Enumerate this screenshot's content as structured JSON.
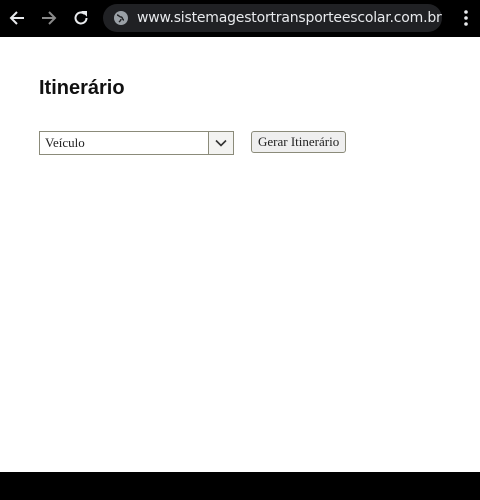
{
  "browser": {
    "url": "www.sistemagestortransporteescolar.com.br",
    "icons": {
      "back": "arrow-left-icon",
      "forward": "arrow-right-icon",
      "reload": "reload-icon",
      "site_info": "globe-icon",
      "menu": "kebab-menu-icon"
    }
  },
  "page": {
    "title": "Itinerário",
    "vehicle_select": {
      "selected": "Veículo",
      "icon": "chevron-down-icon"
    },
    "generate_button_label": "Gerar Itinerário"
  },
  "colors": {
    "chrome_background": "#000000",
    "address_bar": "#202124",
    "url_text": "#e8eaed",
    "page_background": "#ffffff"
  }
}
